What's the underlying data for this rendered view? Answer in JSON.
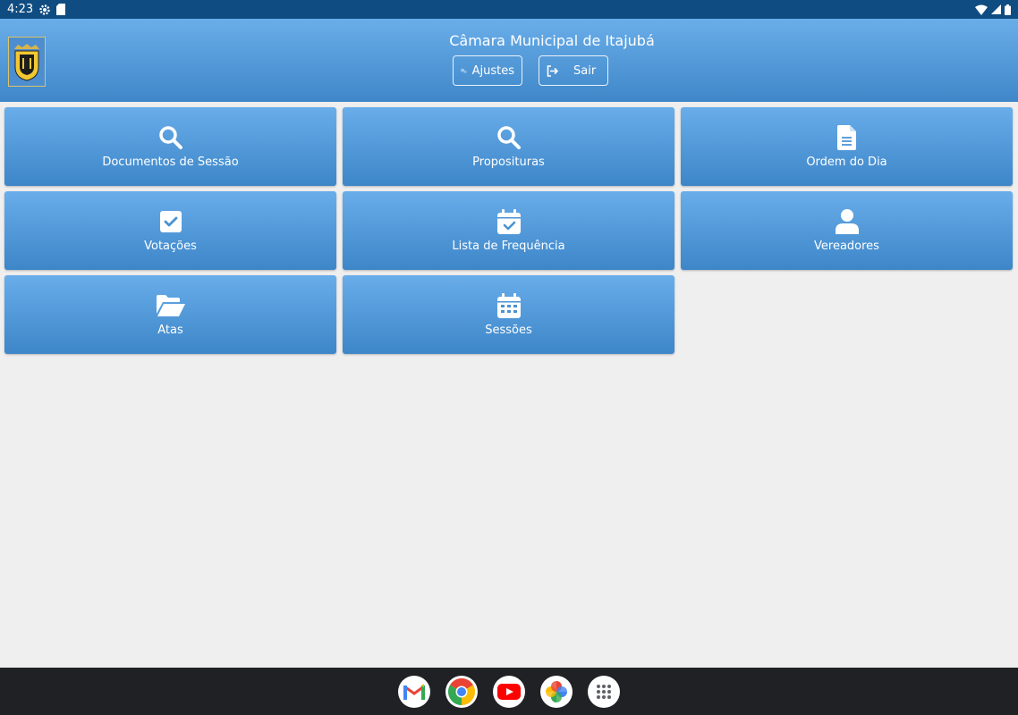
{
  "status": {
    "time": "4:23"
  },
  "header": {
    "title": "Câmara Municipal de Itajubá",
    "buttons": {
      "settings": "Ajustes",
      "logout": "Sair"
    }
  },
  "tiles": [
    {
      "label": "Documentos de Sessão",
      "icon": "search-icon"
    },
    {
      "label": "Proposituras",
      "icon": "search-icon"
    },
    {
      "label": "Ordem do Dia",
      "icon": "document-icon"
    },
    {
      "label": "Votações",
      "icon": "checkbox-icon"
    },
    {
      "label": "Lista de Frequência",
      "icon": "calendar-check-icon"
    },
    {
      "label": "Vereadores",
      "icon": "user-icon"
    },
    {
      "label": "Atas",
      "icon": "folder-open-icon"
    },
    {
      "label": "Sessões",
      "icon": "calendar-icon"
    }
  ],
  "dock": [
    "gmail-icon",
    "chrome-icon",
    "youtube-icon",
    "photos-icon",
    "app-drawer-icon"
  ],
  "colors": {
    "status_bar": "#0f4c81",
    "tile_top": "#69adea",
    "tile_bottom": "#3d86c8",
    "nav_bar": "#202124"
  }
}
